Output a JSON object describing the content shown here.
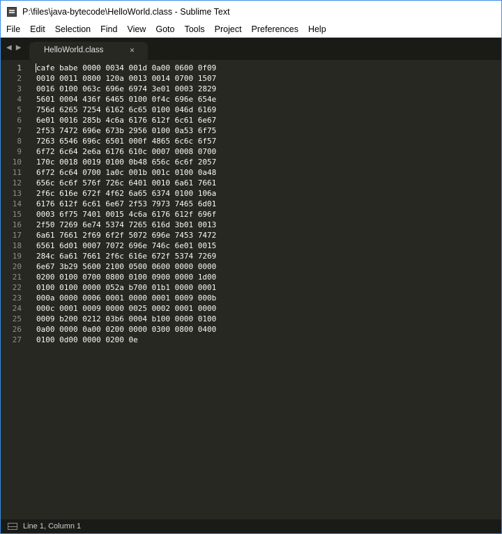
{
  "window": {
    "title": "P:\\files\\java-bytecode\\HelloWorld.class - Sublime Text"
  },
  "menu": [
    "File",
    "Edit",
    "Selection",
    "Find",
    "View",
    "Goto",
    "Tools",
    "Project",
    "Preferences",
    "Help"
  ],
  "tabs": [
    {
      "label": "HelloWorld.class",
      "close": "×"
    }
  ],
  "nav": {
    "back": "◀",
    "forward": "▶"
  },
  "editor": {
    "current_line": 1,
    "lines": [
      "cafe babe 0000 0034 001d 0a00 0600 0f09",
      "0010 0011 0800 120a 0013 0014 0700 1507",
      "0016 0100 063c 696e 6974 3e01 0003 2829",
      "5601 0004 436f 6465 0100 0f4c 696e 654e",
      "756d 6265 7254 6162 6c65 0100 046d 6169",
      "6e01 0016 285b 4c6a 6176 612f 6c61 6e67",
      "2f53 7472 696e 673b 2956 0100 0a53 6f75",
      "7263 6546 696c 6501 000f 4865 6c6c 6f57",
      "6f72 6c64 2e6a 6176 610c 0007 0008 0700",
      "170c 0018 0019 0100 0b48 656c 6c6f 2057",
      "6f72 6c64 0700 1a0c 001b 001c 0100 0a48",
      "656c 6c6f 576f 726c 6401 0010 6a61 7661",
      "2f6c 616e 672f 4f62 6a65 6374 0100 106a",
      "6176 612f 6c61 6e67 2f53 7973 7465 6d01",
      "0003 6f75 7401 0015 4c6a 6176 612f 696f",
      "2f50 7269 6e74 5374 7265 616d 3b01 0013",
      "6a61 7661 2f69 6f2f 5072 696e 7453 7472",
      "6561 6d01 0007 7072 696e 746c 6e01 0015",
      "284c 6a61 7661 2f6c 616e 672f 5374 7269",
      "6e67 3b29 5600 2100 0500 0600 0000 0000",
      "0200 0100 0700 0800 0100 0900 0000 1d00",
      "0100 0100 0000 052a b700 01b1 0000 0001",
      "000a 0000 0006 0001 0000 0001 0009 000b",
      "000c 0001 0009 0000 0025 0002 0001 0000",
      "0009 b200 0212 03b6 0004 b100 0000 0100",
      "0a00 0000 0a00 0200 0000 0300 0800 0400",
      "0100 0d00 0000 0200 0e"
    ]
  },
  "status": {
    "position": "Line 1, Column 1"
  },
  "colors": {
    "editor_bg": "#272822",
    "chrome_bg": "#1a1a17",
    "text": "#f8f8f2",
    "gutter_text": "#8f908a"
  }
}
